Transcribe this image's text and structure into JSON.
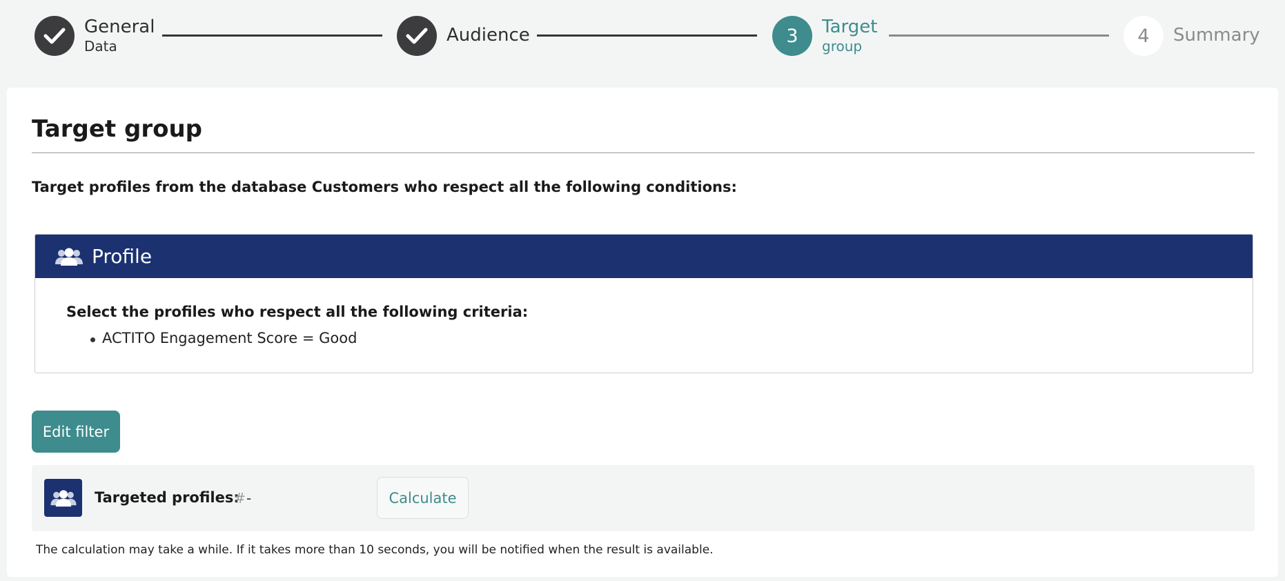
{
  "stepper": {
    "steps": [
      {
        "state": "done",
        "number": "",
        "label1": "General",
        "label2": "Data"
      },
      {
        "state": "done",
        "number": "",
        "label1": "Audience",
        "label2": ""
      },
      {
        "state": "active",
        "number": "3",
        "label1": "Target",
        "label2": "group"
      },
      {
        "state": "todo",
        "number": "4",
        "label1": "Summary",
        "label2": ""
      }
    ]
  },
  "card": {
    "title": "Target group",
    "intro": "Target profiles from the database Customers who respect all the following conditions:",
    "profile_box": {
      "header_icon": "users-icon",
      "header_title": "Profile",
      "criteria_heading": "Select the profiles who respect all the following criteria:",
      "criteria": [
        "ACTITO Engagement Score = Good"
      ]
    },
    "edit_filter_label": "Edit filter",
    "count": {
      "icon": "users-icon",
      "label": "Targeted profiles:",
      "hash": "#",
      "value": "-",
      "calculate_label": "Calculate"
    },
    "note": "The calculation may take a while. If it takes more than 10 seconds, you will be notified when the result is available."
  },
  "colors": {
    "accent": "#3e8c8e",
    "done": "#3c3c3f",
    "header_navy": "#1b3170"
  }
}
